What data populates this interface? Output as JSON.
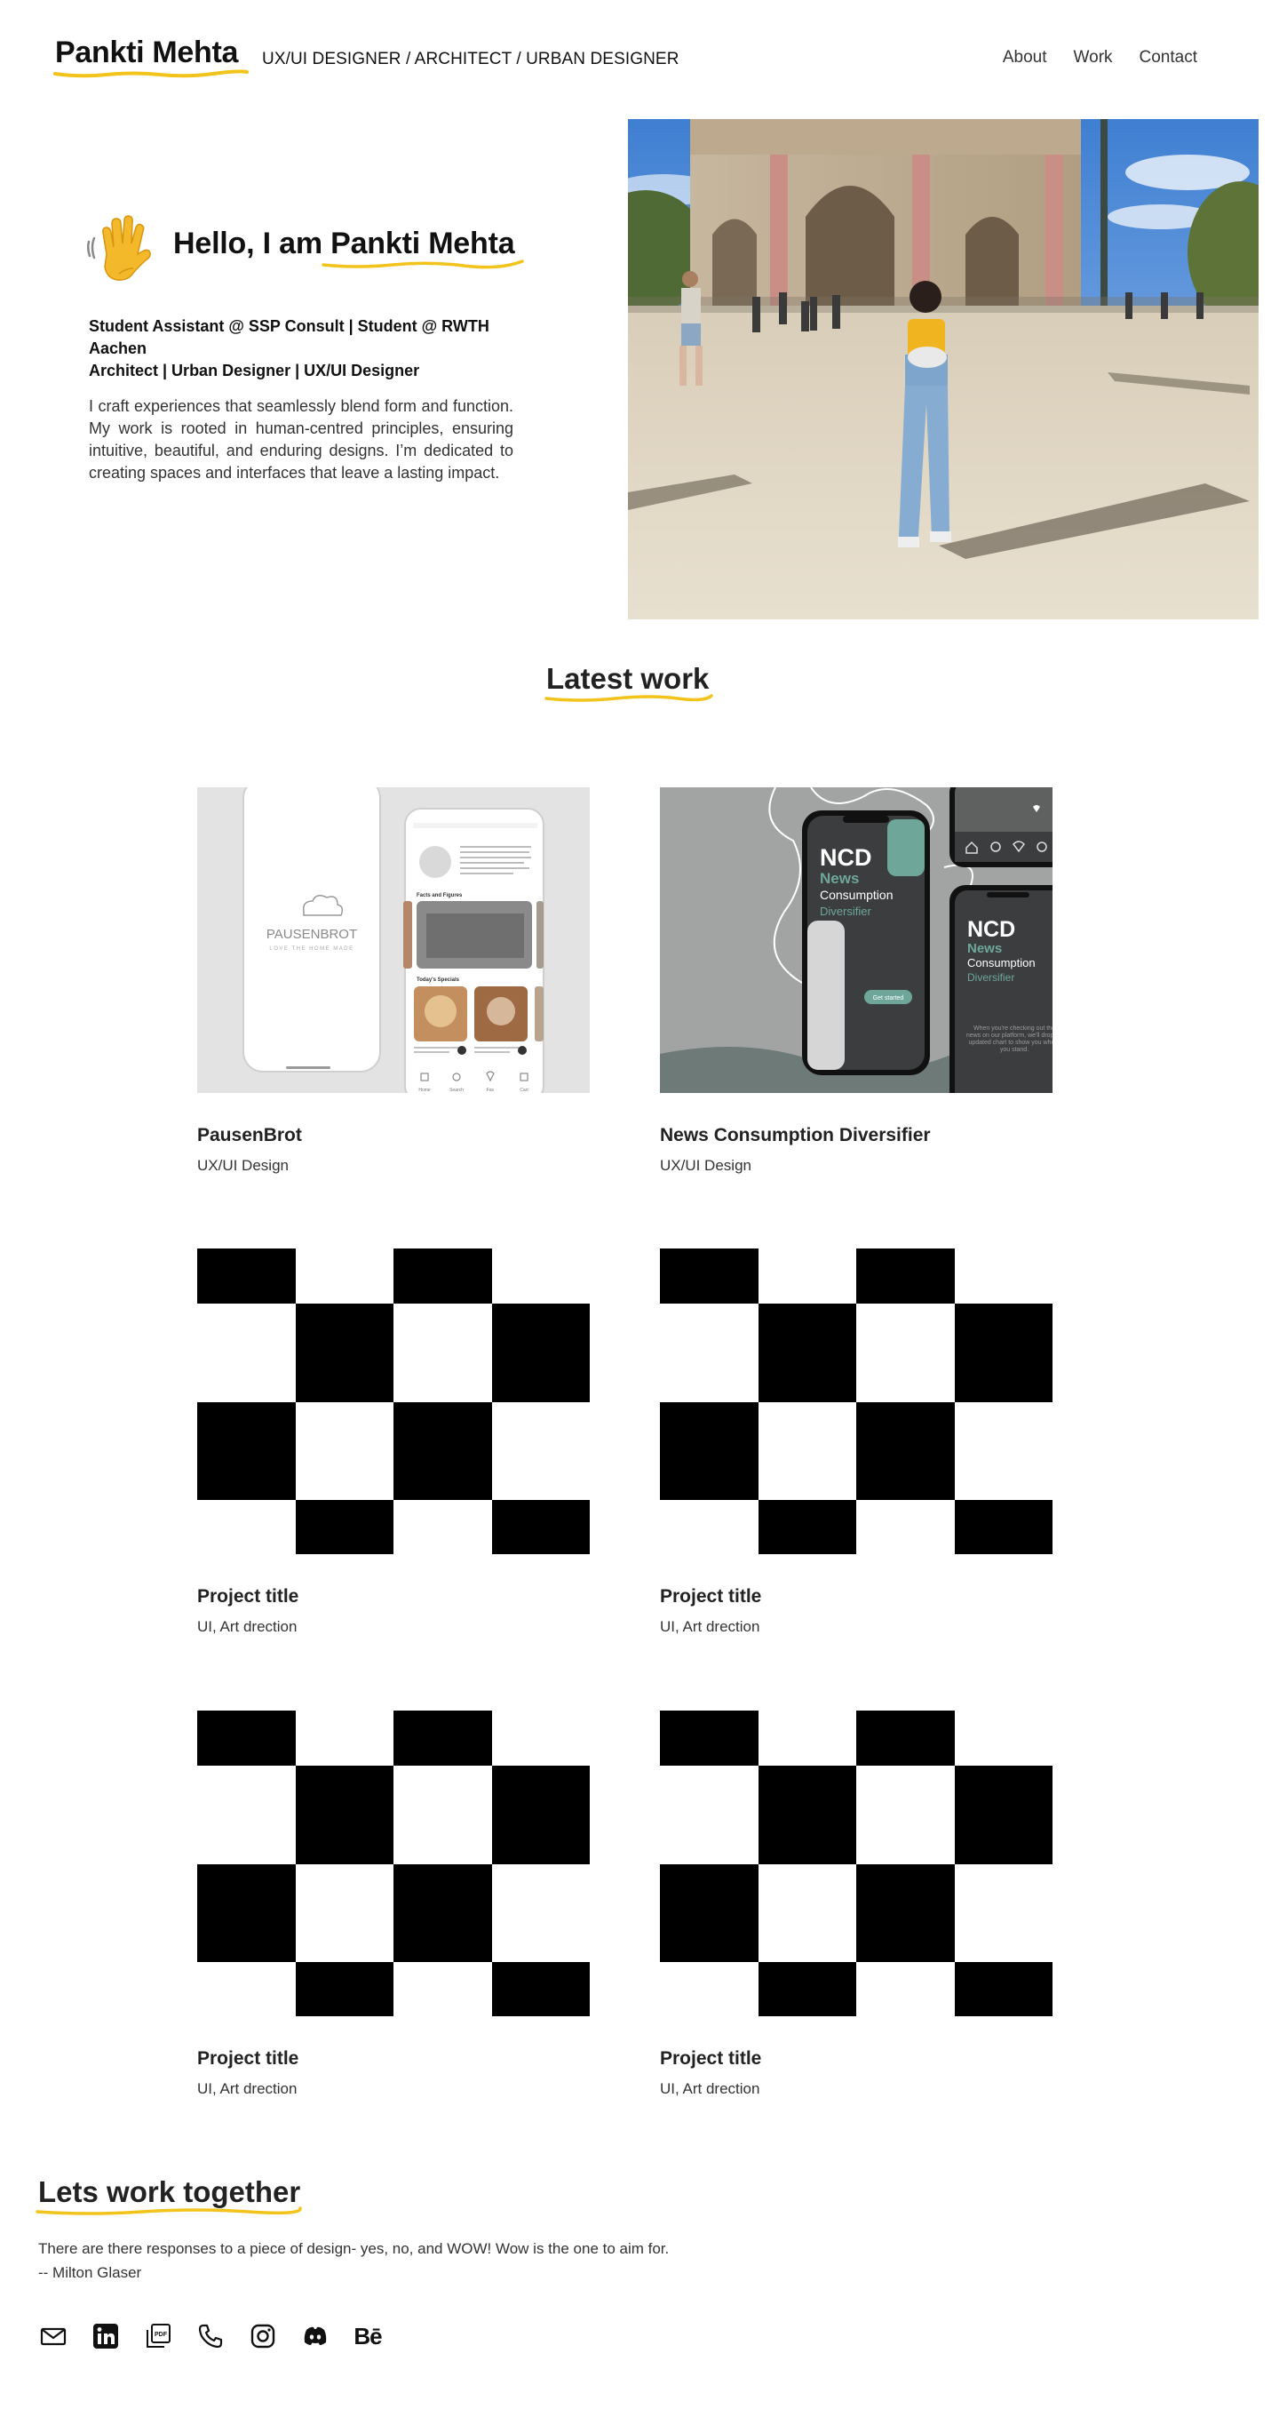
{
  "header": {
    "logo": "Pankti Mehta",
    "tagline": "UX/UI DESIGNER / ARCHITECT / URBAN DESIGNER",
    "nav": [
      "About",
      "Work",
      "Contact"
    ]
  },
  "hero": {
    "greeting_prefix": "Hello, I am ",
    "greeting_name": "Pankti Mehta",
    "roles_line1": "Student Assistant @ SSP Consult | Student @ RWTH Aachen",
    "roles_line2": "Architect | Urban Designer | UX/UI Designer",
    "intro": "I craft experiences that seamlessly blend form and function. My work is rooted in human-centred principles, ensuring intuitive, beautiful, and enduring designs. I’m dedicated to creating spaces and interfaces that leave a lasting impact."
  },
  "latest_work": {
    "title": "Latest work",
    "projects": [
      {
        "title": "PausenBrot",
        "subtitle": "UX/UI Design",
        "mock": {
          "brand": "PAUSENBROT",
          "brand_tagline": "LOVE THE HOME MADE",
          "section1": "Facts and Figures",
          "section2": "Today's Specials",
          "nav": [
            "Home",
            "Search",
            "Fav",
            "Cart"
          ]
        }
      },
      {
        "title": "News Consumption Diversifier",
        "subtitle": "UX/UI Design",
        "mock": {
          "brand_line1": "NCD",
          "brand_line2": "News",
          "brand_line3": "Consumption",
          "brand_line4": "Diversifier",
          "button": "Get started",
          "blurb": "When you're checking out the news on our platform, we'll drop an updated chart to show you where you stand."
        }
      },
      {
        "title": "Project title",
        "subtitle": "UI, Art drection"
      },
      {
        "title": "Project title",
        "subtitle": "UI, Art drection"
      },
      {
        "title": "Project title",
        "subtitle": "UI, Art drection"
      },
      {
        "title": "Project title",
        "subtitle": "UI, Art drection"
      }
    ]
  },
  "contact": {
    "title": "Lets work together",
    "quote_line1": "There are there responses to a piece of design- yes, no, and WOW! Wow is the one to aim for.",
    "quote_line2": "-- Milton Glaser",
    "socials": [
      "mail-icon",
      "linkedin-icon",
      "pdf-icon",
      "phone-icon",
      "instagram-icon",
      "discord-icon",
      "behance-icon"
    ],
    "behance_label": "Bē"
  },
  "colors": {
    "accent_yellow": "#f2c31b",
    "teal": "#6ea79a",
    "text": "#222222"
  }
}
